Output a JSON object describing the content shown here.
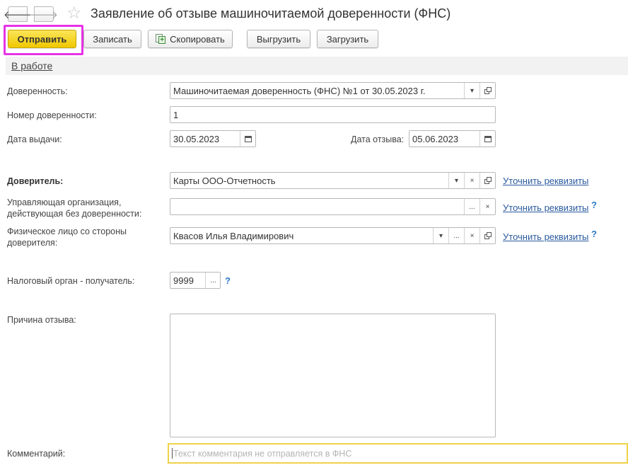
{
  "header": {
    "back_glyph": "🡐",
    "forward_glyph": "🡒",
    "favorite_glyph": "☆",
    "title": "Заявление об отзыве машиночитаемой доверенности (ФНС)"
  },
  "toolbar": {
    "send_label": "Отправить",
    "save_label": "Записать",
    "copy_label": "Скопировать",
    "export_label": "Выгрузить",
    "import_label": "Загрузить",
    "highlight_color": "#e633e6",
    "primary_color": "#f5d20c"
  },
  "status": {
    "label": "В работе"
  },
  "form": {
    "power_of_attorney": {
      "label": "Доверенность:",
      "value": "Машиночитаемая доверенность (ФНС) №1 от 30.05.2023 г."
    },
    "number": {
      "label": "Номер доверенности:",
      "value": "1"
    },
    "issue_date": {
      "label": "Дата выдачи:",
      "value": "30.05.2023"
    },
    "revoke_date": {
      "label": "Дата отзыва:",
      "value": "05.06.2023"
    },
    "principal": {
      "label": "Доверитель:",
      "value": "Карты ООО-Отчетность",
      "link": "Уточнить реквизиты"
    },
    "managing_org": {
      "label_line1": "Управляющая организация,",
      "label_line2": "действующая без доверенности:",
      "value": "",
      "link": "Уточнить реквизиты",
      "help": "?"
    },
    "individual": {
      "label_line1": "Физическое лицо со стороны",
      "label_line2": "доверителя:",
      "value": "Квасов Илья Владимирович",
      "link": "Уточнить реквизиты",
      "help": "?"
    },
    "tax_authority": {
      "label": "Налоговый орган - получатель:",
      "value": "9999",
      "help": "?"
    },
    "reason": {
      "label": "Причина отзыва:",
      "value": ""
    },
    "comment": {
      "label": "Комментарий:",
      "placeholder": "Текст комментария не отправляется в ФНС",
      "value": ""
    }
  },
  "icons": {
    "dropdown": "▾",
    "clear": "×",
    "choose": "...",
    "open": "open-icon",
    "calendar": "calendar-icon",
    "copy": "copy-icon"
  }
}
